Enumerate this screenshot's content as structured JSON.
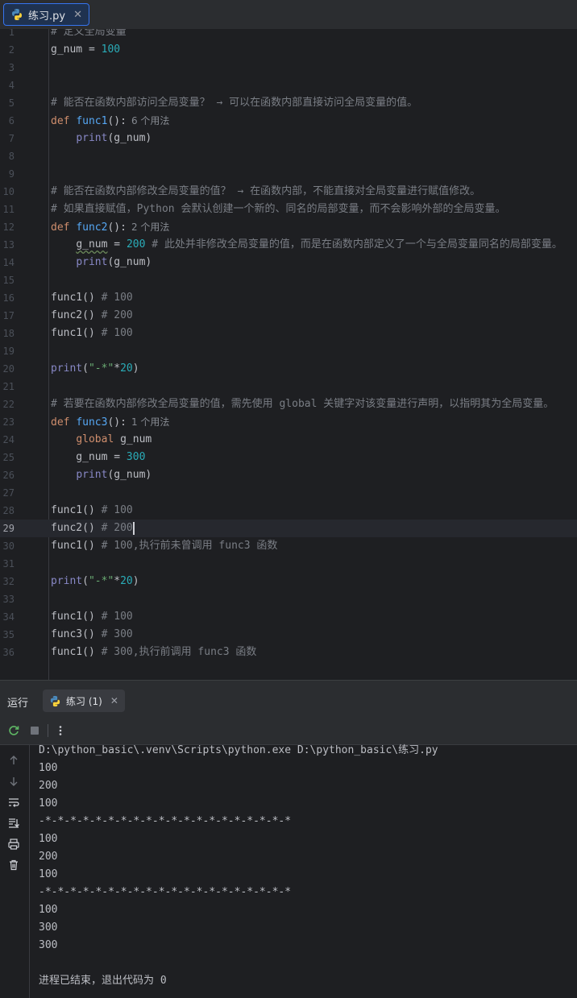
{
  "editor": {
    "tab_title": "练习.py",
    "lines": [
      {
        "n": "1",
        "code": "<span class=\"cm\"># 定义全局变量</span>"
      },
      {
        "n": "2",
        "code": "g_num = <span class=\"num-lit\">100</span>"
      },
      {
        "n": "3",
        "code": ""
      },
      {
        "n": "4",
        "code": ""
      },
      {
        "n": "5",
        "code": "<span class=\"cm\"># 能否在函数内部访问全局变量？ → 可以在函数内部直接访问全局变量的值。</span>"
      },
      {
        "n": "6",
        "code": "<span class=\"kw\">def</span> <span class=\"fn\">func1</span>():<span class=\"hint\">6 个用法</span>"
      },
      {
        "n": "7",
        "code": "    <span class=\"bi\">print</span>(g_num)"
      },
      {
        "n": "8",
        "code": ""
      },
      {
        "n": "9",
        "code": ""
      },
      {
        "n": "10",
        "code": "<span class=\"cm\"># 能否在函数内部修改全局变量的值？ → 在函数内部，不能直接对全局变量进行赋值修改。</span>"
      },
      {
        "n": "11",
        "code": "<span class=\"cm\"># 如果直接赋值，Python 会默认创建一个新的、同名的局部变量，而不会影响外部的全局变量。</span>"
      },
      {
        "n": "12",
        "code": "<span class=\"kw\">def</span> <span class=\"fn\">func2</span>():<span class=\"hint\">2 个用法</span>"
      },
      {
        "n": "13",
        "code": "    <span class=\"wavy\">g_num</span> = <span class=\"num-lit\">200</span> <span class=\"cm\"># 此处并非修改全局变量的值，而是在函数内部定义了一个与全局变量同名的局部变量。</span>"
      },
      {
        "n": "14",
        "code": "    <span class=\"bi\">print</span>(g_num)"
      },
      {
        "n": "15",
        "code": ""
      },
      {
        "n": "16",
        "code": "func1() <span class=\"cm\"># 100</span>"
      },
      {
        "n": "17",
        "code": "func2() <span class=\"cm\"># 200</span>"
      },
      {
        "n": "18",
        "code": "func1() <span class=\"cm\"># 100</span>"
      },
      {
        "n": "19",
        "code": ""
      },
      {
        "n": "20",
        "code": "<span class=\"bi\">print</span>(<span class=\"str\">\"-*\"</span>*<span class=\"num-lit\">20</span>)"
      },
      {
        "n": "21",
        "code": ""
      },
      {
        "n": "22",
        "code": "<span class=\"cm\"># 若要在函数内部修改全局变量的值，需先使用 global 关键字对该变量进行声明，以指明其为全局变量。</span>"
      },
      {
        "n": "23",
        "code": "<span class=\"kw\">def</span> <span class=\"fn\">func3</span>():<span class=\"hint\">1 个用法</span>"
      },
      {
        "n": "24",
        "code": "    <span class=\"kw\">global</span> g_num"
      },
      {
        "n": "25",
        "code": "    g_num = <span class=\"num-lit\">300</span>"
      },
      {
        "n": "26",
        "code": "    <span class=\"bi\">print</span>(g_num)"
      },
      {
        "n": "27",
        "code": ""
      },
      {
        "n": "28",
        "code": "func1() <span class=\"cm\"># 100</span>"
      },
      {
        "n": "29",
        "code": "func2() <span class=\"cm\"># 200</span><span class=\"caret\"></span>",
        "current": true
      },
      {
        "n": "30",
        "code": "func1() <span class=\"cm\"># 100,执行前未曾调用 func3 函数</span>"
      },
      {
        "n": "31",
        "code": ""
      },
      {
        "n": "32",
        "code": "<span class=\"bi\">print</span>(<span class=\"str\">\"-*\"</span>*<span class=\"num-lit\">20</span>)"
      },
      {
        "n": "33",
        "code": ""
      },
      {
        "n": "34",
        "code": "func1() <span class=\"cm\"># 100</span>"
      },
      {
        "n": "35",
        "code": "func3() <span class=\"cm\"># 300</span>"
      },
      {
        "n": "36",
        "code": "func1() <span class=\"cm\"># 300,执行前调用 func3 函数</span>"
      }
    ]
  },
  "run_panel": {
    "title": "运行",
    "tab_label": "练习 (1)",
    "output": [
      "D:\\python_basic\\.venv\\Scripts\\python.exe D:\\python_basic\\练习.py",
      "100",
      "200",
      "100",
      "-*-*-*-*-*-*-*-*-*-*-*-*-*-*-*-*-*-*-*-*",
      "100",
      "200",
      "100",
      "-*-*-*-*-*-*-*-*-*-*-*-*-*-*-*-*-*-*-*-*",
      "100",
      "300",
      "300",
      "",
      "进程已结束，退出代码为 0"
    ]
  },
  "colors": {
    "accent": "#3574f0",
    "background": "#1e1f22",
    "panel": "#2b2d30"
  }
}
